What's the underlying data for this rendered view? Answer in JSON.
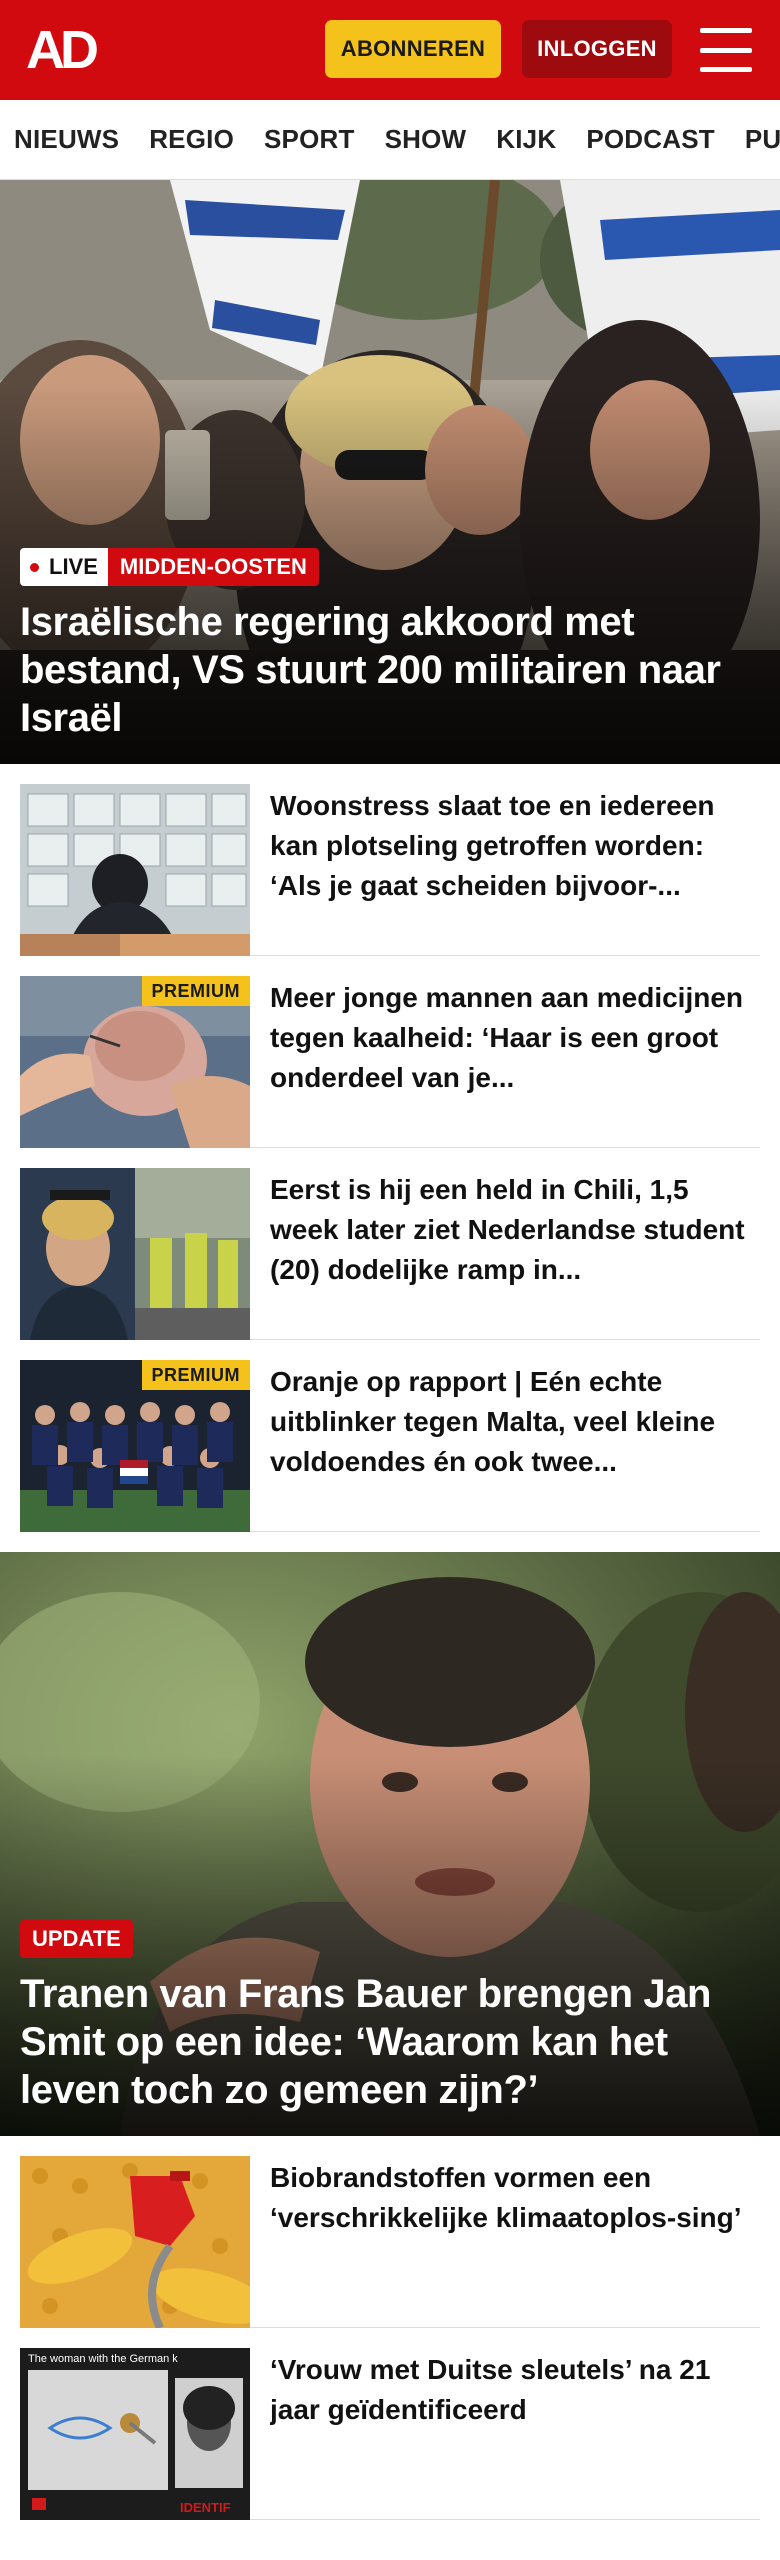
{
  "header": {
    "logo": "AD",
    "subscribe_label": "ABONNEREN",
    "login_label": "INLOGGEN"
  },
  "nav": [
    "NIEUWS",
    "REGIO",
    "SPORT",
    "SHOW",
    "KIJK",
    "PODCAST",
    "PUZZ"
  ],
  "hero": {
    "live_label": "LIVE",
    "category": "MIDDEN-OOSTEN",
    "title": "Israëlische regering akkoord met bestand, VS stuurt 200 militairen naar Israël"
  },
  "articles": [
    {
      "title": "Woonstress slaat toe en iedereen kan plotseling getroffen worden: ‘Als je gaat scheiden bijvoor-...",
      "premium": ""
    },
    {
      "title": "Meer jonge mannen aan medicijnen tegen kaalheid: ‘Haar is een groot onderdeel van je...",
      "premium": "PREMIUM"
    },
    {
      "title": "Eerst is hij een held in Chili, 1,5 week later ziet Nederlandse student (20) dodelijke ramp in...",
      "premium": ""
    },
    {
      "title": "Oranje op rapport | Eén echte uitblinker tegen Malta, veel kleine voldoendes én ook twee...",
      "premium": "PREMIUM"
    }
  ],
  "feature": {
    "tag": "UPDATE",
    "title": "Tranen van Frans Bauer brengen Jan Smit op een idee: ‘Waarom kan het leven toch zo gemeen zijn?’"
  },
  "articles2": [
    {
      "title": "Biobrandstoffen vormen een ‘verschrikkelijke klimaatoplos-sing’"
    },
    {
      "title": "‘Vrouw met Duitse sleutels’ na 21 jaar geïdentificeerd",
      "image_caption": "The woman with the German k",
      "image_badge": "IDENTIF"
    }
  ],
  "colors": {
    "brand_red": "#d10a10",
    "premium_yellow": "#f5c21b",
    "login_dark": "#9e0b0f"
  }
}
